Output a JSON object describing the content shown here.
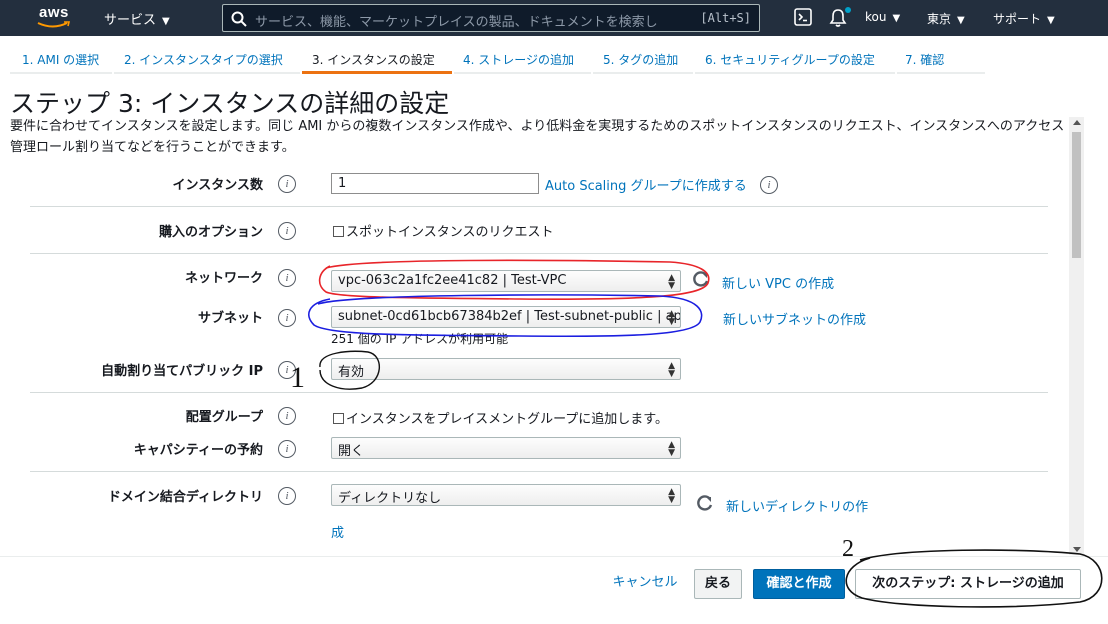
{
  "header": {
    "logo_text": "aws",
    "services_label": "サービス",
    "search_placeholder": "サービス、機能、マーケットプレイスの製品、ドキュメントを検索し",
    "search_shortcut": "[Alt+S]",
    "user_label": "kou",
    "region_label": "東京",
    "support_label": "サポート"
  },
  "steps": [
    {
      "label": "1. AMI の選択"
    },
    {
      "label": "2. インスタンスタイプの選択"
    },
    {
      "label": "3. インスタンスの設定"
    },
    {
      "label": "4. ストレージの追加"
    },
    {
      "label": "5. タグの追加"
    },
    {
      "label": "6. セキュリティグループの設定"
    },
    {
      "label": "7. 確認"
    }
  ],
  "page": {
    "title": "ステップ 3: インスタンスの詳細の設定",
    "description": "要件に合わせてインスタンスを設定します。同じ AMI からの複数インスタンス作成や、より低料金を実現するためのスポットインスタンスのリクエスト、インスタンスへのアクセス管理ロール割り当てなどを行うことができます。"
  },
  "form": {
    "instance_count": {
      "label": "インスタンス数",
      "value": "1",
      "link": "Auto Scaling グループに作成する"
    },
    "purchase_option": {
      "label": "購入のオプション",
      "checkbox_label": "スポットインスタンスのリクエスト"
    },
    "network": {
      "label": "ネットワーク",
      "value": "vpc-063c2a1fc2ee41c82 | Test-VPC",
      "link": "新しい VPC の作成"
    },
    "subnet": {
      "label": "サブネット",
      "value": "subnet-0cd61bcb67384b2ef | Test-subnet-public | ap",
      "link": "新しいサブネットの作成",
      "note": "251 個の IP アドレスが利用可能"
    },
    "public_ip": {
      "label": "自動割り当てパブリック IP",
      "value": "有効"
    },
    "placement_group": {
      "label": "配置グループ",
      "checkbox_label": "インスタンスをプレイスメントグループに追加します。"
    },
    "capacity_reservation": {
      "label": "キャパシティーの予約",
      "value": "開く"
    },
    "domain_directory": {
      "label": "ドメイン結合ディレクトリ",
      "value": "ディレクトリなし",
      "link_line1": "新しいディレクトリの作",
      "link_line2": "成"
    }
  },
  "footer": {
    "cancel_label": "キャンセル",
    "back_label": "戻る",
    "review_label": "確認と作成",
    "next_label": "次のステップ: ストレージの追加"
  },
  "annotations": {
    "mark_1": "1",
    "mark_2": "2"
  },
  "colors": {
    "nav_bg": "#232f3e",
    "accent_orange": "#ec7211",
    "link_blue": "#0073bb",
    "annot_red": "#e8252a",
    "annot_blue": "#1b1ee0"
  }
}
